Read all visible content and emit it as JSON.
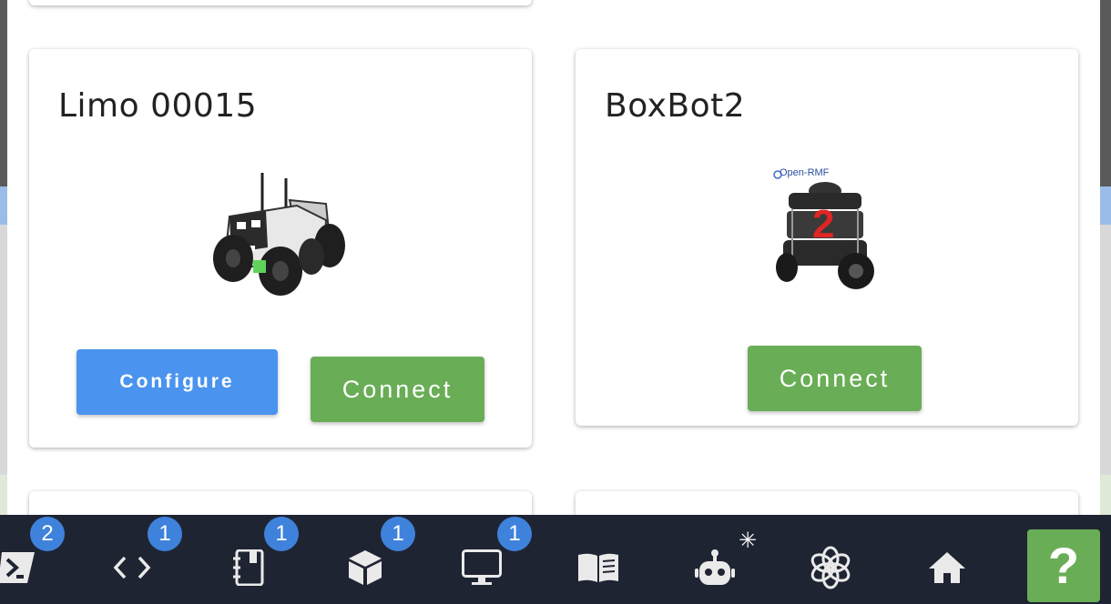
{
  "cards": [
    {
      "name": "Limo 00015",
      "configure_label": "Configure",
      "connect_label": "Connect"
    },
    {
      "name": "BoxBot2",
      "image_logo_text": "Open-RMF",
      "image_number": "2",
      "connect_label": "Connect"
    }
  ],
  "toolbar": {
    "items": [
      {
        "icon": "terminal-icon",
        "badge": "2"
      },
      {
        "icon": "code-icon",
        "badge": "1"
      },
      {
        "icon": "notebook-icon",
        "badge": "1"
      },
      {
        "icon": "box-icon",
        "badge": "1"
      },
      {
        "icon": "monitor-icon",
        "badge": "1"
      },
      {
        "icon": "book-icon"
      },
      {
        "icon": "robot-icon",
        "marker": "✳"
      },
      {
        "icon": "openai-icon"
      },
      {
        "icon": "home-icon"
      }
    ],
    "help_label": "?"
  },
  "colors": {
    "configure": "#4a93ee",
    "connect": "#69ad56",
    "toolbar": "#1f2433",
    "badge": "#3f82dc"
  }
}
